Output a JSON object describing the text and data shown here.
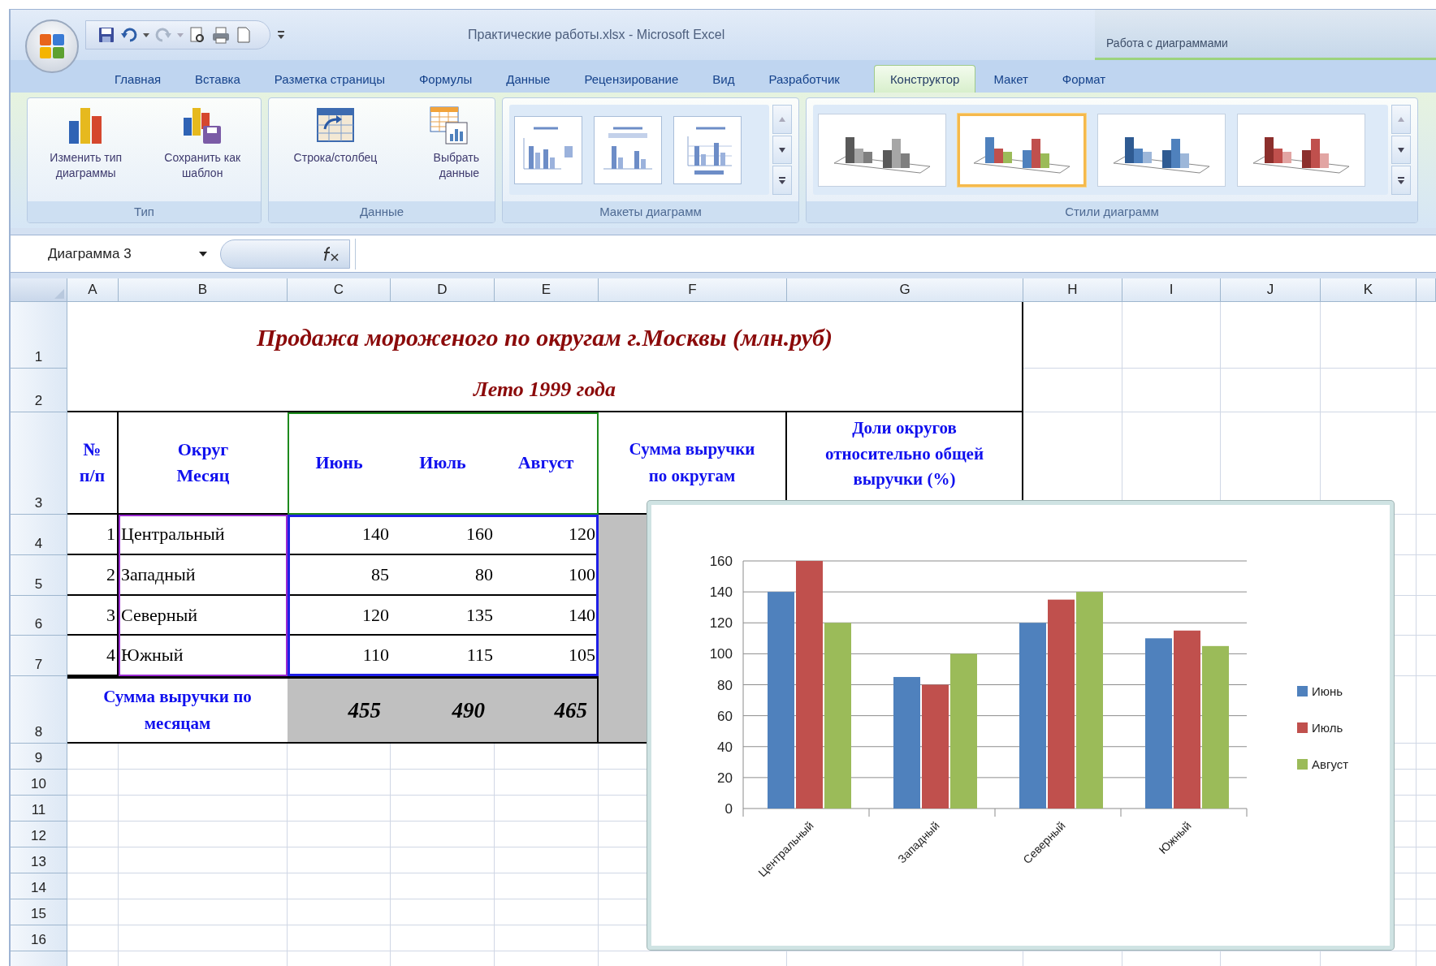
{
  "window": {
    "title": "Практические работы.xlsx - Microsoft Excel",
    "context_group": "Работа с диаграммами"
  },
  "tabs": [
    {
      "label": "Главная",
      "selected": false
    },
    {
      "label": "Вставка",
      "selected": false
    },
    {
      "label": "Разметка страницы",
      "selected": false
    },
    {
      "label": "Формулы",
      "selected": false
    },
    {
      "label": "Данные",
      "selected": false
    },
    {
      "label": "Рецензирование",
      "selected": false
    },
    {
      "label": "Вид",
      "selected": false
    },
    {
      "label": "Разработчик",
      "selected": false
    },
    {
      "label": "Конструктор",
      "selected": true
    },
    {
      "label": "Макет",
      "selected": false
    },
    {
      "label": "Формат",
      "selected": false
    }
  ],
  "ribbon": {
    "groups": [
      {
        "label": "Тип",
        "buttons": [
          {
            "label": "Изменить тип диаграммы",
            "kind": "change"
          },
          {
            "label": "Сохранить как шаблон",
            "kind": "template"
          }
        ]
      },
      {
        "label": "Данные",
        "buttons": [
          {
            "label": "Строка/столбец",
            "kind": "switch"
          },
          {
            "label": "Выбрать данные",
            "kind": "select"
          }
        ]
      }
    ],
    "layouts_label": "Макеты диаграмм",
    "styles_label": "Стили диаграмм",
    "styles": [
      {
        "kind": "gray",
        "selected": false
      },
      {
        "kind": "multicolor",
        "selected": true
      },
      {
        "kind": "blue",
        "selected": false
      },
      {
        "kind": "red",
        "selected": false
      }
    ]
  },
  "formula_bar": {
    "name_box": "Диаграмма 3"
  },
  "sheet": {
    "columns": [
      "A",
      "B",
      "C",
      "D",
      "E",
      "F",
      "G",
      "H",
      "I",
      "J",
      "K"
    ],
    "rows": [
      "1",
      "2",
      "3",
      "4",
      "5",
      "6",
      "7",
      "8",
      "9",
      "10",
      "11",
      "12",
      "13",
      "14",
      "15",
      "16"
    ],
    "title": "Продажа мороженого по округам г.Москвы (млн.руб)",
    "subtitle": "Лето 1999 года",
    "header": [
      "№\nп/п",
      "Округ\nМесяц",
      "Июнь",
      "Июль",
      "Август",
      "Сумма выручки\nпо округам",
      "Доли округов\nотносительно общей\nвыручки (%)"
    ],
    "data": [
      {
        "num": "1",
        "district": "Центральный",
        "values": [
          "140",
          "160",
          "120"
        ]
      },
      {
        "num": "2",
        "district": "Западный",
        "values": [
          "85",
          "80",
          "100"
        ]
      },
      {
        "num": "3",
        "district": "Северный",
        "values": [
          "120",
          "135",
          "140"
        ]
      },
      {
        "num": "4",
        "district": "Южный",
        "values": [
          "110",
          "115",
          "105"
        ]
      }
    ],
    "total": {
      "label": "Сумма выручки по\nмесяцам",
      "values": [
        "455",
        "490",
        "465"
      ]
    }
  },
  "chart": {
    "chart_data": {
      "type": "bar",
      "categories": [
        "Центральный",
        "Западный",
        "Северный",
        "Южный"
      ],
      "series": [
        {
          "name": "Июнь",
          "color": "#4f81bd",
          "values": [
            140,
            85,
            120,
            110
          ]
        },
        {
          "name": "Июль",
          "color": "#c0504d",
          "values": [
            160,
            80,
            135,
            115
          ]
        },
        {
          "name": "Август",
          "color": "#9bbb59",
          "values": [
            120,
            100,
            140,
            105
          ]
        }
      ],
      "legend": "right",
      "grid": true,
      "ylim": [
        0,
        160
      ],
      "yticks": [
        0,
        20,
        40,
        60,
        80,
        100,
        120,
        140,
        160
      ]
    }
  }
}
